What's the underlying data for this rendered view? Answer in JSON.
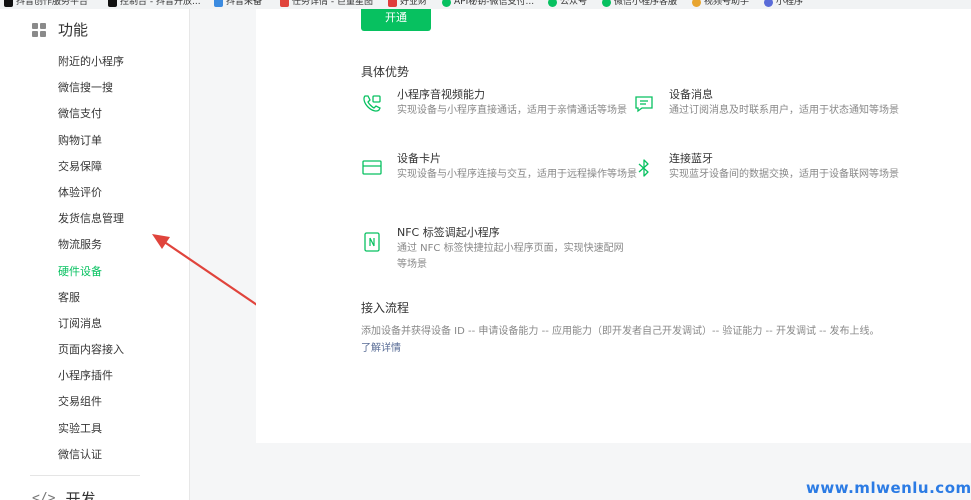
{
  "bookmarks": [
    {
      "label": "抖音创作服务平台",
      "icon": "douyin-icon",
      "color": "#111111"
    },
    {
      "label": "控制台 - 抖音开放...",
      "icon": "douyin-icon",
      "color": "#111111"
    },
    {
      "label": "抖音采备",
      "icon": "bird-icon",
      "color": "#3b8be0"
    },
    {
      "label": "任务详情 - 巨量星图",
      "icon": "star-map-icon",
      "color": "#e0443c"
    },
    {
      "label": "好业财",
      "icon": "haoyecai-icon",
      "color": "#e03c3c"
    },
    {
      "label": "API秘钥-微信支付...",
      "icon": "wechat-icon",
      "color": "#07c160"
    },
    {
      "label": "公众号",
      "icon": "official-account-icon",
      "color": "#07c160"
    },
    {
      "label": "微信小程序客服",
      "icon": "wechat-icon",
      "color": "#07c160"
    },
    {
      "label": "视频号助手",
      "icon": "channels-icon",
      "color": "#e8a530"
    },
    {
      "label": "小程序",
      "icon": "miniprogram-icon",
      "color": "#5a6cd8"
    }
  ],
  "sidebar": {
    "section_title": "功能",
    "items": [
      {
        "label": "附近的小程序",
        "active": false
      },
      {
        "label": "微信搜一搜",
        "active": false
      },
      {
        "label": "微信支付",
        "active": false
      },
      {
        "label": "购物订单",
        "active": false
      },
      {
        "label": "交易保障",
        "active": false
      },
      {
        "label": "体验评价",
        "active": false
      },
      {
        "label": "发货信息管理",
        "active": false
      },
      {
        "label": "物流服务",
        "active": false
      },
      {
        "label": "硬件设备",
        "active": true
      },
      {
        "label": "客服",
        "active": false
      },
      {
        "label": "订阅消息",
        "active": false
      },
      {
        "label": "页面内容接入",
        "active": false
      },
      {
        "label": "小程序插件",
        "active": false
      },
      {
        "label": "交易组件",
        "active": false
      },
      {
        "label": "实验工具",
        "active": false
      },
      {
        "label": "微信认证",
        "active": false
      }
    ],
    "dev_section_title": "开发"
  },
  "main": {
    "open_button": "开通",
    "advantages_title": "具体优势",
    "features": [
      {
        "title": "小程序音视频能力",
        "desc": "实现设备与小程序直接通话，适用于亲情通话等场景",
        "icon": "video-call-icon"
      },
      {
        "title": "设备消息",
        "desc": "通过订阅消息及时联系用户，适用于状态通知等场景",
        "icon": "message-icon"
      },
      {
        "title": "设备卡片",
        "desc": "实现设备与小程序连接与交互，适用于远程操作等场景",
        "icon": "card-icon"
      },
      {
        "title": "连接蓝牙",
        "desc": "实现蓝牙设备间的数据交换，适用于设备联网等场景",
        "icon": "bluetooth-icon"
      },
      {
        "title": "NFC 标签调起小程序",
        "desc": "通过 NFC 标签快捷拉起小程序页面，实现快速配网等场景",
        "icon": "nfc-icon"
      }
    ],
    "process_title": "接入流程",
    "process_text": "添加设备并获得设备 ID -- 申请设备能力 -- 应用能力（即开发者自己开发调试）-- 验证能力 -- 开发调试 -- 发布上线。",
    "more_link": "了解详情"
  },
  "watermark": "www.mlwenlu.com",
  "colors": {
    "accent": "#07c160",
    "link": "#576b95",
    "arrow": "#e0443c",
    "watermark": "#2b7be4"
  }
}
